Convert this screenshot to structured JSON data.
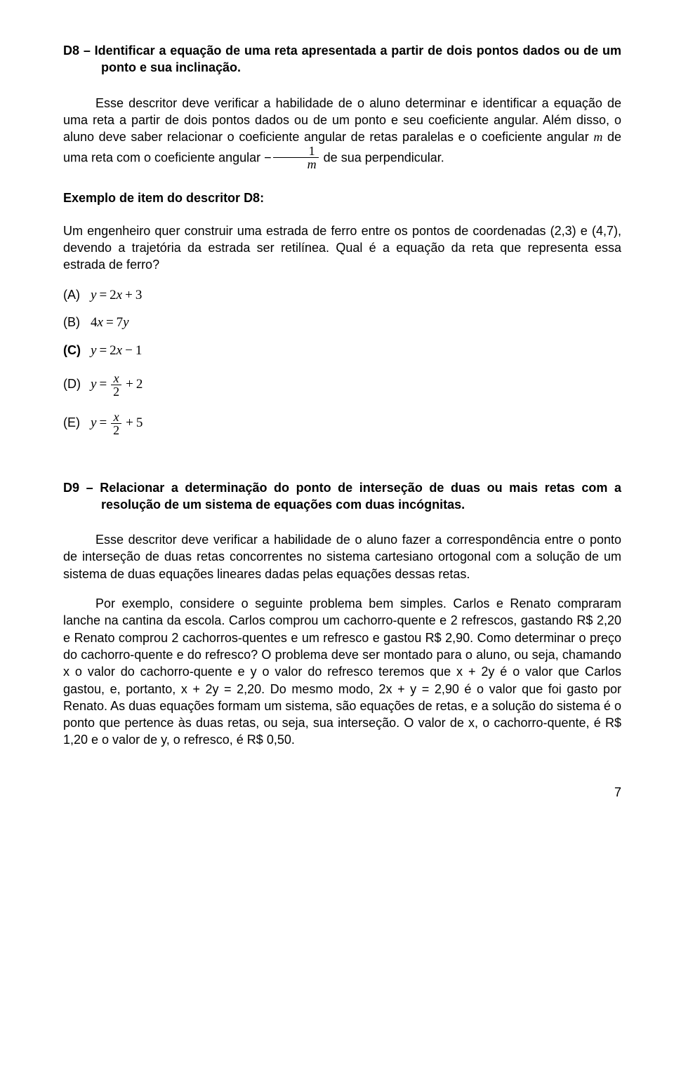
{
  "d8": {
    "heading_prefix": "D8 – ",
    "heading_text": "Identificar a equação de uma reta apresentada a partir de dois pontos dados ou de um ponto e sua inclinação.",
    "para1_a": "Esse descritor deve verificar a habilidade de o aluno determinar e identificar a equação de uma reta a partir de dois pontos dados ou de um ponto e seu coeficiente angular. Além disso, o aluno deve saber relacionar o coeficiente angular de retas paralelas e o coeficiente angular ",
    "m_var": "m",
    "para1_b": " de uma reta com o coeficiente angular ",
    "minus_sign": "−",
    "frac_num": "1",
    "frac_den": "m",
    "para1_c": " de sua perpendicular.",
    "example_label": "Exemplo de item do descritor D8:",
    "example_text": "Um engenheiro quer construir uma estrada de ferro entre os pontos de coordenadas (2,3) e (4,7), devendo a trajetória da estrada ser retilínea. Qual é a equação da reta que representa essa estrada de ferro?",
    "options": {
      "A": {
        "label": "(A)",
        "lhs": "y",
        "eq": "=",
        "rhs_a": "2",
        "rhs_b": "x",
        "op": "+",
        "rhs_c": "3"
      },
      "B": {
        "label": "(B)",
        "lhs_a": "4",
        "lhs_b": "x",
        "eq": "=",
        "rhs_a": "7",
        "rhs_b": "y"
      },
      "C": {
        "label": "(C)",
        "lhs": "y",
        "eq": "=",
        "rhs_a": "2",
        "rhs_b": "x",
        "op": "−",
        "rhs_c": "1"
      },
      "D": {
        "label": "(D)",
        "lhs": "y",
        "eq": "=",
        "fnum": "x",
        "fden": "2",
        "op": "+",
        "rhs_c": "2"
      },
      "E": {
        "label": "(E)",
        "lhs": "y",
        "eq": "=",
        "fnum": "x",
        "fden": "2",
        "op": "+",
        "rhs_c": "5"
      }
    }
  },
  "d9": {
    "heading_prefix": "D9 – ",
    "heading_text": "Relacionar a determinação do ponto de interseção de duas ou mais retas com a resolução de um sistema de equações com duas incógnitas.",
    "para1": "Esse descritor deve verificar a habilidade de o aluno fazer a correspondência entre o ponto de interseção de duas retas concorrentes no sistema cartesiano ortogonal com a solução de um sistema de duas equações lineares dadas pelas equações dessas retas.",
    "para2": "Por exemplo, considere o seguinte problema bem simples. Carlos e Renato compraram lanche na cantina da escola. Carlos comprou um cachorro-quente e 2 refrescos, gastando R$ 2,20 e Renato comprou 2 cachorros-quentes e um refresco e gastou R$ 2,90. Como determinar o preço do cachorro-quente e do refresco? O problema deve ser montado para o aluno, ou seja, chamando x o valor do cachorro-quente e y o valor do refresco teremos que x + 2y é o valor que Carlos gastou, e, portanto, x + 2y = 2,20. Do mesmo modo, 2x + y = 2,90 é o valor que foi gasto por Renato. As duas equações formam um sistema, são equações de retas, e a solução do sistema é o ponto que pertence às duas retas, ou seja, sua interseção. O valor de x, o cachorro-quente, é R$ 1,20 e o valor de y, o refresco, é R$ 0,50."
  },
  "page_number": "7"
}
